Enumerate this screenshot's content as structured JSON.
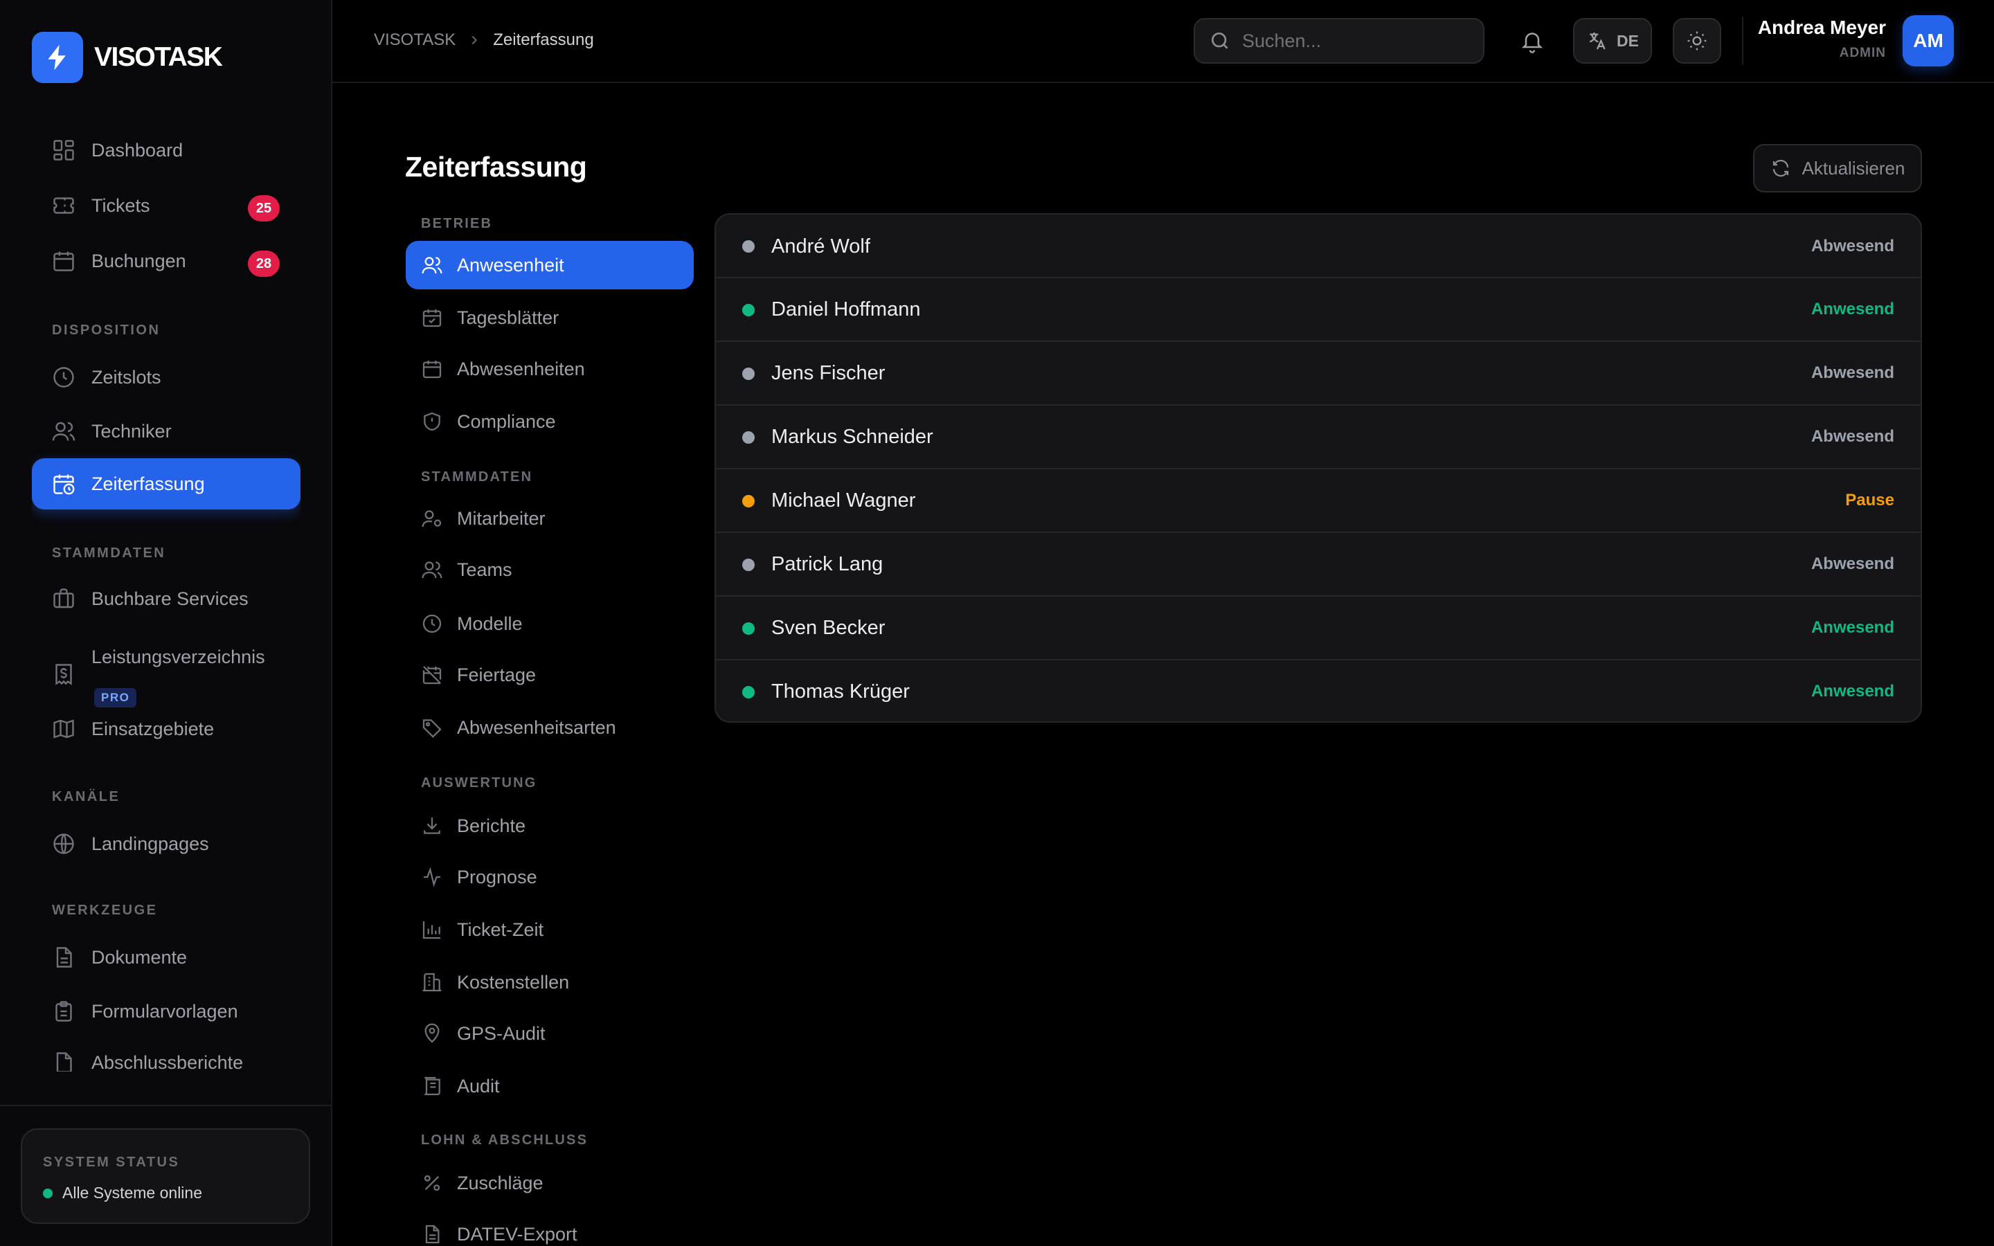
{
  "brand": {
    "name": "VISOTASK"
  },
  "sidebar": {
    "items": [
      {
        "label": "Dashboard",
        "icon": "dashboard-icon"
      },
      {
        "label": "Tickets",
        "icon": "ticket-icon",
        "badge": "25"
      },
      {
        "label": "Buchungen",
        "icon": "calendar-icon",
        "badge": "28"
      }
    ],
    "sections": {
      "disposition": {
        "label": "DISPOSITION",
        "items": [
          {
            "label": "Zeitslots",
            "icon": "clock-icon"
          },
          {
            "label": "Techniker",
            "icon": "users-icon"
          },
          {
            "label": "Zeiterfassung",
            "icon": "calendar-clock-icon",
            "active": true
          }
        ]
      },
      "stammdaten": {
        "label": "STAMMDATEN",
        "items": [
          {
            "label": "Buchbare Services",
            "icon": "briefcase-icon"
          },
          {
            "label": "Leistungsverzeichnis",
            "icon": "receipt-icon",
            "badge": "PRO"
          },
          {
            "label": "Einsatzgebiete",
            "icon": "map-icon"
          }
        ]
      },
      "kanaele": {
        "label": "KANÄLE",
        "items": [
          {
            "label": "Landingpages",
            "icon": "globe-icon"
          }
        ]
      },
      "werkzeuge": {
        "label": "WERKZEUGE",
        "items": [
          {
            "label": "Dokumente",
            "icon": "document-icon"
          },
          {
            "label": "Formularvorlagen",
            "icon": "clipboard-icon"
          },
          {
            "label": "Abschlussberichte",
            "icon": "report-icon"
          }
        ]
      }
    },
    "system_status": {
      "title": "SYSTEM STATUS",
      "text": "Alle Systeme online",
      "color": "#10b981"
    }
  },
  "header": {
    "breadcrumb": {
      "root": "VISOTASK",
      "current": "Zeiterfassung"
    },
    "search": {
      "placeholder": "Suchen...",
      "value": ""
    },
    "language": "DE",
    "user": {
      "name": "Andrea Meyer",
      "role": "ADMIN",
      "initials": "AM"
    }
  },
  "main": {
    "title": "Zeiterfassung",
    "refresh_label": "Aktualisieren",
    "subnav": {
      "betrieb": {
        "label": "BETRIEB",
        "items": [
          {
            "label": "Anwesenheit",
            "icon": "users-icon",
            "active": true
          },
          {
            "label": "Tagesblätter",
            "icon": "calendar-check-icon"
          },
          {
            "label": "Abwesenheiten",
            "icon": "calendar-icon"
          },
          {
            "label": "Compliance",
            "icon": "shield-icon"
          }
        ]
      },
      "stammdaten": {
        "label": "STAMMDATEN",
        "items": [
          {
            "label": "Mitarbeiter",
            "icon": "user-settings-icon"
          },
          {
            "label": "Teams",
            "icon": "users-icon"
          },
          {
            "label": "Modelle",
            "icon": "clock-icon"
          },
          {
            "label": "Feiertage",
            "icon": "calendar-off-icon"
          },
          {
            "label": "Abwesenheitsarten",
            "icon": "tag-icon"
          }
        ]
      },
      "auswertung": {
        "label": "AUSWERTUNG",
        "items": [
          {
            "label": "Berichte",
            "icon": "download-icon"
          },
          {
            "label": "Prognose",
            "icon": "activity-icon"
          },
          {
            "label": "Ticket-Zeit",
            "icon": "bar-chart-icon"
          },
          {
            "label": "Kostenstellen",
            "icon": "building-icon"
          },
          {
            "label": "GPS-Audit",
            "icon": "map-pin-icon"
          },
          {
            "label": "Audit",
            "icon": "scroll-icon"
          }
        ]
      },
      "lohn": {
        "label": "LOHN & ABSCHLUSS",
        "items": [
          {
            "label": "Zuschläge",
            "icon": "percent-icon"
          },
          {
            "label": "DATEV-Export",
            "icon": "file-icon"
          }
        ]
      }
    },
    "attendance": [
      {
        "name": "André Wolf",
        "status": "Abwesend",
        "color": "#9ca3af"
      },
      {
        "name": "Daniel Hoffmann",
        "status": "Anwesend",
        "color": "#10b981"
      },
      {
        "name": "Jens Fischer",
        "status": "Abwesend",
        "color": "#9ca3af"
      },
      {
        "name": "Markus Schneider",
        "status": "Abwesend",
        "color": "#9ca3af"
      },
      {
        "name": "Michael Wagner",
        "status": "Pause",
        "color": "#f59e0b"
      },
      {
        "name": "Patrick Lang",
        "status": "Abwesend",
        "color": "#9ca3af"
      },
      {
        "name": "Sven Becker",
        "status": "Anwesend",
        "color": "#10b981"
      },
      {
        "name": "Thomas Krüger",
        "status": "Anwesend",
        "color": "#10b981"
      }
    ]
  },
  "colors": {
    "accent": "#2563eb",
    "badge": "#e11d48",
    "present": "#10b981",
    "absent": "#9ca3af",
    "pause": "#f59e0b"
  }
}
